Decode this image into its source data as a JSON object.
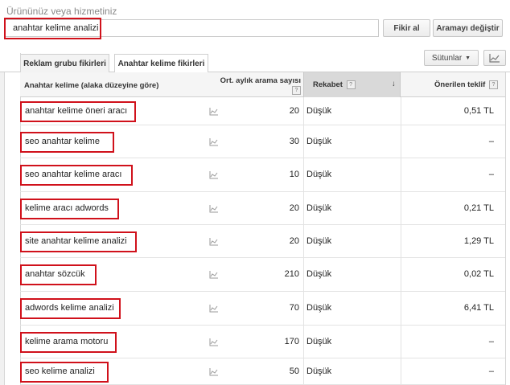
{
  "prompt": "Ürününüz veya hizmetiniz",
  "search": {
    "value": "anahtar kelime analizi"
  },
  "buttons": {
    "get_ideas": "Fikir al",
    "edit_search": "Aramayı değiştir",
    "columns": "Sütunlar"
  },
  "tabs": [
    "Reklam grubu fikirleri",
    "Anahtar kelime fikirleri"
  ],
  "columns": {
    "keyword": "Anahtar kelime (alaka düzeyine göre)",
    "avg_searches": "Ort. aylık arama sayısı",
    "competition": "Rekabet",
    "suggested_bid": "Önerilen teklif",
    "help": "?"
  },
  "rows": [
    {
      "keyword": "anahtar kelime öneri aracı",
      "searches": "20",
      "competition": "Düşük",
      "bid": "0,51 TL"
    },
    {
      "keyword": "seo anahtar kelime",
      "searches": "30",
      "competition": "Düşük",
      "bid": "–"
    },
    {
      "keyword": "seo anahtar kelime aracı",
      "searches": "10",
      "competition": "Düşük",
      "bid": "–"
    },
    {
      "keyword": "kelime aracı adwords",
      "searches": "20",
      "competition": "Düşük",
      "bid": "0,21 TL"
    },
    {
      "keyword": "site anahtar kelime analizi",
      "searches": "20",
      "competition": "Düşük",
      "bid": "1,29 TL"
    },
    {
      "keyword": "anahtar sözcük",
      "searches": "210",
      "competition": "Düşük",
      "bid": "0,02 TL"
    },
    {
      "keyword": "adwords kelime analizi",
      "searches": "70",
      "competition": "Düşük",
      "bid": "6,41 TL"
    },
    {
      "keyword": "kelime arama motoru",
      "searches": "170",
      "competition": "Düşük",
      "bid": "–"
    },
    {
      "keyword": "seo kelime analizi",
      "searches": "50",
      "competition": "Düşük",
      "bid": "–"
    }
  ],
  "colors": {
    "highlight": "#d0111b",
    "header_bg": "#f5f5f5",
    "sorted_col_bg": "#d9d9d9"
  },
  "icons": [
    "chart-icon",
    "sort-down-arrow-icon",
    "help-icon",
    "dropdown-caret-icon"
  ]
}
